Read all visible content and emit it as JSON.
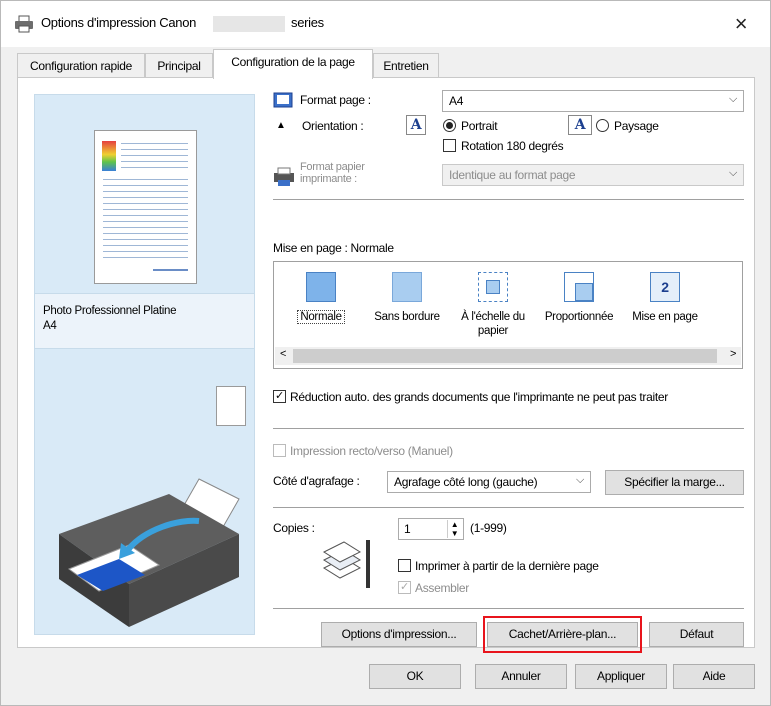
{
  "window": {
    "title": "Options d'impression Canon",
    "title_suffix": "series",
    "close_label": "×"
  },
  "tabs": [
    "Configuration rapide",
    "Principal",
    "Configuration de la page",
    "Entretien"
  ],
  "preview": {
    "media_line1": "Photo Professionnel Platine",
    "media_line2": "A4"
  },
  "page_size": {
    "label": "Format page :",
    "value": "A4"
  },
  "orientation": {
    "label": "Orientation :",
    "icon_glyph": "A",
    "portrait_label": "Portrait",
    "landscape_label": "Paysage",
    "rotate_label": "Rotation 180 degrés",
    "selected": "Portrait"
  },
  "printer_paper": {
    "label_line1": "Format papier",
    "label_line2": "imprimante :",
    "value": "Identique au format page"
  },
  "layout": {
    "label": "Mise en page : Normale",
    "items": [
      {
        "label": "Normale",
        "label2": ""
      },
      {
        "label": "Sans bordure",
        "label2": ""
      },
      {
        "label": "À l'échelle du",
        "label2": "papier"
      },
      {
        "label": "Proportionnée",
        "label2": ""
      },
      {
        "label": "Mise en page",
        "label2": ""
      }
    ],
    "scroll_left": "<",
    "scroll_right": ">",
    "page_layout_glyph": "2"
  },
  "reduce_label": "Réduction auto. des grands documents que l'imprimante ne peut pas traiter",
  "duplex_label": "Impression recto/verso (Manuel)",
  "stapling": {
    "label": "Côté d'agrafage :",
    "value": "Agrafage côté long (gauche)",
    "margin_button": "Spécifier la marge..."
  },
  "copies": {
    "label": "Copies :",
    "value": "1",
    "range": "(1-999)",
    "last_page_label": "Imprimer à partir de la dernière page",
    "collate_label": "Assembler"
  },
  "buttons": {
    "print_options": "Options d'impression...",
    "stamp": "Cachet/Arrière-plan...",
    "defaults": "Défaut",
    "ok": "OK",
    "cancel": "Annuler",
    "apply": "Appliquer",
    "help": "Aide"
  },
  "colors": {
    "highlight": "#e8141c",
    "preview_bg": "#d9eaf7",
    "accent_blue": "#1c3f8f"
  }
}
